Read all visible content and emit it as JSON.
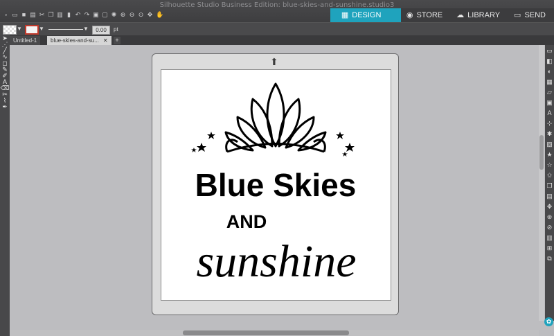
{
  "window": {
    "title": "Silhouette Studio Business Edition: blue-skies-and-sunshine.studio3"
  },
  "nav": {
    "tabs": [
      {
        "label": "DESIGN",
        "icon": "grid-icon"
      },
      {
        "label": "STORE",
        "icon": "store-icon"
      },
      {
        "label": "LIBRARY",
        "icon": "cloud-icon"
      },
      {
        "label": "SEND",
        "icon": "cutter-icon"
      }
    ],
    "active_tab": "DESIGN",
    "accent_color": "#1fa3bd"
  },
  "properties": {
    "line_width": "0.00",
    "line_unit": "pt"
  },
  "documents": {
    "tabs": [
      {
        "label": "Untitled-1"
      },
      {
        "label": "blue-skies-and-su..."
      }
    ],
    "active": 1
  },
  "design": {
    "line1": "Blue Skies",
    "line2": "AND",
    "line3": "sunshine"
  },
  "toolbar_icons": [
    "new-icon",
    "open-icon",
    "save-icon",
    "print-icon",
    "cut-icon",
    "copy-icon",
    "paste-icon",
    "delete-icon",
    "undo-icon",
    "redo-icon",
    "group-icon",
    "ungroup-icon",
    "select-all-icon",
    "zoom-in-icon",
    "zoom-out-icon",
    "zoom-fit-icon",
    "pan-icon",
    "zoom-icon"
  ]
}
